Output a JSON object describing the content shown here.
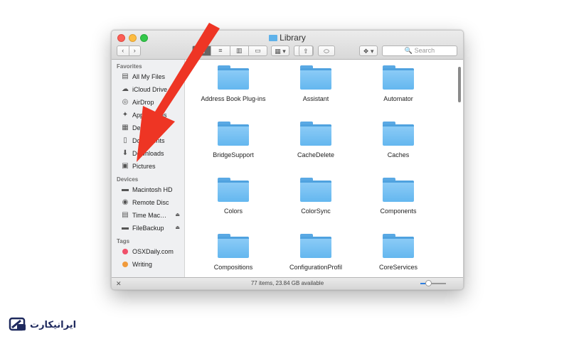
{
  "window": {
    "title": "Library",
    "nav": {
      "back": "‹",
      "forward": "›"
    },
    "toolbar": {
      "view_icons": "▦",
      "view_list": "≡",
      "view_columns": "▥",
      "view_coverflow": "▭",
      "arrange": "▦ ▾",
      "action": "✲ ▾",
      "share": "⇧",
      "tags": "⬭",
      "dropbox": "❖ ▾"
    },
    "search_placeholder": "🔍 Search",
    "status": "77 items, 23.84 GB available",
    "zoom_level": 0.3
  },
  "sidebar": {
    "sections": [
      {
        "header": "Favorites",
        "items": [
          {
            "label": "All My Files",
            "icon": "▤"
          },
          {
            "label": "iCloud Drive",
            "icon": "☁"
          },
          {
            "label": "AirDrop",
            "icon": "◎"
          },
          {
            "label": "Applications",
            "icon": "✦"
          },
          {
            "label": "Desktop",
            "icon": "▦"
          },
          {
            "label": "Documents",
            "icon": "▯"
          },
          {
            "label": "Downloads",
            "icon": "⬇"
          },
          {
            "label": "Pictures",
            "icon": "▣"
          }
        ]
      },
      {
        "header": "Devices",
        "items": [
          {
            "label": "Macintosh HD",
            "icon": "▬",
            "eject": ""
          },
          {
            "label": "Remote Disc",
            "icon": "◉",
            "eject": ""
          },
          {
            "label": "Time Mac…",
            "icon": "▤",
            "eject": "⏏"
          },
          {
            "label": "FileBackup",
            "icon": "▬",
            "eject": "⏏"
          }
        ]
      },
      {
        "header": "Tags",
        "items": [
          {
            "label": "OSXDaily.com",
            "color": "#f0506a"
          },
          {
            "label": "Writing",
            "color": "#f09a3c"
          }
        ]
      }
    ]
  },
  "folders": [
    {
      "name": "Address Book Plug-ins"
    },
    {
      "name": "Assistant"
    },
    {
      "name": "Automator"
    },
    {
      "name": "BridgeSupport"
    },
    {
      "name": "CacheDelete"
    },
    {
      "name": "Caches"
    },
    {
      "name": "Colors"
    },
    {
      "name": "ColorSync"
    },
    {
      "name": "Components"
    },
    {
      "name": "Compositions"
    },
    {
      "name": "ConfigurationProfil"
    },
    {
      "name": "CoreServices"
    }
  ],
  "colors": {
    "arrow": "#ee3524",
    "folder": "#6cbcf1",
    "logo": "#1f2a5e"
  },
  "logo": {
    "text": "ایرانیکارت"
  }
}
